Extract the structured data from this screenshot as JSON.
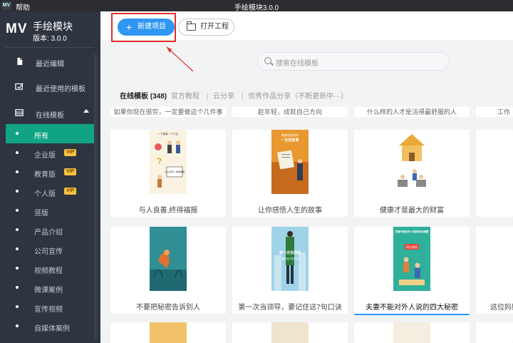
{
  "titlebar": {
    "app_icon": "MV",
    "help": "帮助",
    "title": "手绘模块3.0.0"
  },
  "brand": {
    "logo": "MV",
    "name": "手绘模块",
    "version": "版本: 3.0.0"
  },
  "nav": {
    "recent_edit": "最近编辑",
    "recent_templates": "最近使用的模板",
    "online_templates": "在线模板"
  },
  "subnav": [
    {
      "label": "所有",
      "vip": ""
    },
    {
      "label": "企业版",
      "vip": "VIP"
    },
    {
      "label": "教育版",
      "vip": "VIP"
    },
    {
      "label": "个人版",
      "vip": "VIP"
    },
    {
      "label": "竖版",
      "vip": ""
    },
    {
      "label": "产品介绍",
      "vip": ""
    },
    {
      "label": "公司宣传",
      "vip": ""
    },
    {
      "label": "视频教程",
      "vip": ""
    },
    {
      "label": "微课案例",
      "vip": ""
    },
    {
      "label": "宣传视频",
      "vip": ""
    },
    {
      "label": "自媒体案例",
      "vip": ""
    }
  ],
  "toolbar": {
    "new_project": "新建项目",
    "open_project": "打开工程"
  },
  "search": {
    "placeholder": "搜索在线模板"
  },
  "filter": {
    "online": "在线模板 (348)",
    "official": "官方教程",
    "cloud": "云分享",
    "excellent": "优秀作品分享（不断更新中···）"
  },
  "top_partial_captions": [
    "如果你现在很穷，一定要做这个几件事",
    "趁年轻，成就自己方向",
    "什么样的人才是活得最舒服的人",
    "工作"
  ],
  "cards_row1": [
    "与人良善,终得福报",
    "让你感悟人生的故事",
    "健康才是最大的财富"
  ],
  "cards_row2": [
    "不要把秘密告诉别人",
    "第一次当领导，要记住这7句口诀",
    "夫妻不能对外人说的四大秘密",
    "这位妈妈"
  ],
  "thumb_texts": {
    "r1c1_top": "一个故事 一个人生",
    "r1c1_note": "人以善待人 终得福报",
    "r1c2_top": "能够改变你的",
    "r1c2_title": "一生的故事",
    "r2c2_title": "第一次当领导",
    "r2c2_sub": "要记住7句口诀",
    "r2c3_title": "夫妻不能对外人说的四大秘密",
    "r2c3_badge": "四大秘密"
  },
  "colors": {
    "accent": "#2f96f3",
    "active_green": "#11a484",
    "sidebar_bg": "#2e3440",
    "highlight_red": "#e0302a"
  }
}
